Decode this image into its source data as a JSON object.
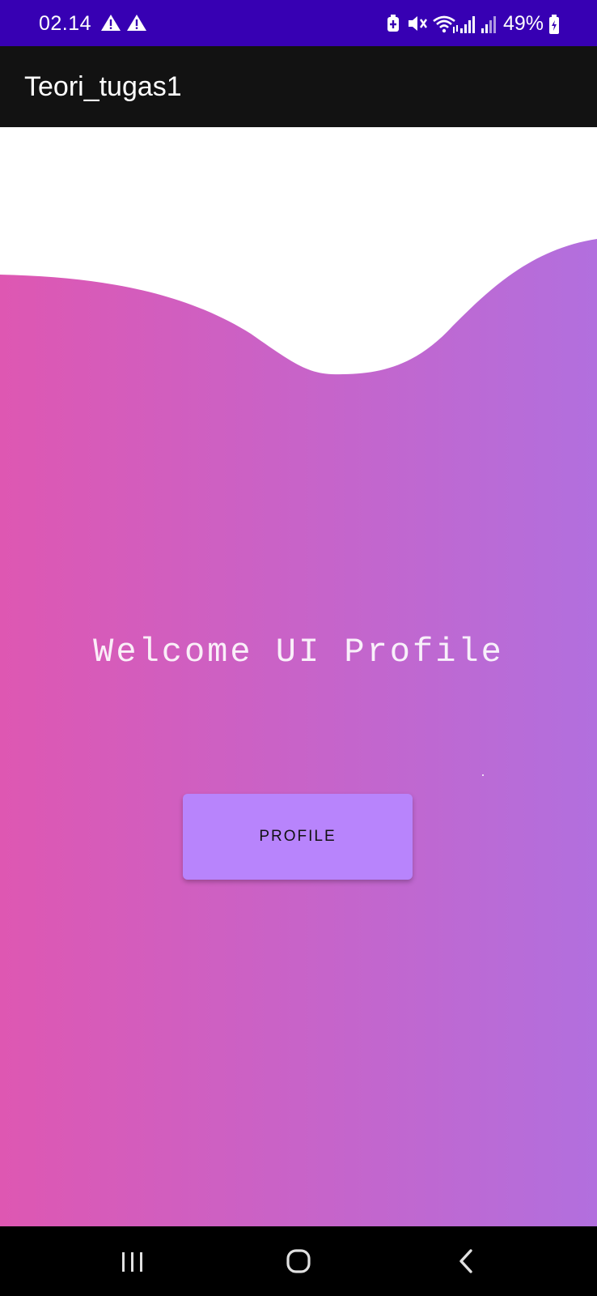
{
  "status_bar": {
    "time": "02.14",
    "battery_percent": "49%",
    "background": "#3700b3",
    "icons": [
      "alert-triangle-icon",
      "alert-triangle-icon",
      "battery-saver-icon",
      "vibrate-mute-icon",
      "wifi-icon",
      "signal-icon",
      "signal-icon",
      "battery-charging-icon"
    ]
  },
  "app_bar": {
    "title": "Teori_tugas1",
    "background": "#121212"
  },
  "main": {
    "welcome_text": "Welcome UI Profile",
    "profile_button_label": "PROFILE",
    "gradient": {
      "start": "#de57b2",
      "end": "#b26fde"
    },
    "button_color": "#b884fc"
  },
  "nav_bar": {
    "buttons": [
      "recent-apps-icon",
      "home-icon",
      "back-icon"
    ]
  }
}
